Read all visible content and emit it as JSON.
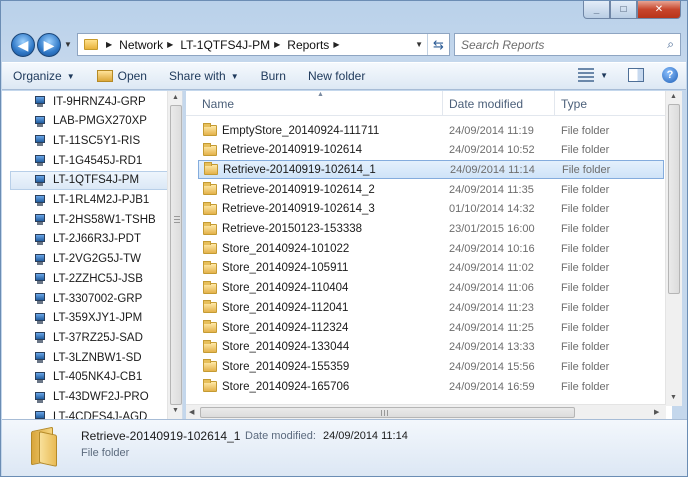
{
  "window": {
    "caption_buttons": [
      "minimize",
      "maximize",
      "close"
    ]
  },
  "address": {
    "crumbs": [
      "Network",
      "LT-1QTFS4J-PM",
      "Reports"
    ]
  },
  "search": {
    "placeholder": "Search Reports"
  },
  "toolbar": {
    "organize": "Organize",
    "open": "Open",
    "share_with": "Share with",
    "burn": "Burn",
    "new_folder": "New folder"
  },
  "nav_pane": {
    "items": [
      {
        "label": "IT-9HRNZ4J-GRP"
      },
      {
        "label": "LAB-PMGX270XP"
      },
      {
        "label": "LT-11SC5Y1-RIS"
      },
      {
        "label": "LT-1G4545J-RD1"
      },
      {
        "label": "LT-1QTFS4J-PM",
        "selected": true
      },
      {
        "label": "LT-1RL4M2J-PJB1"
      },
      {
        "label": "LT-2HS58W1-TSHB"
      },
      {
        "label": "LT-2J66R3J-PDT"
      },
      {
        "label": "LT-2VG2G5J-TW"
      },
      {
        "label": "LT-2ZZHC5J-JSB"
      },
      {
        "label": "LT-3307002-GRP"
      },
      {
        "label": "LT-359XJY1-JPM"
      },
      {
        "label": "LT-37RZ25J-SAD"
      },
      {
        "label": "LT-3LZNBW1-SD"
      },
      {
        "label": "LT-405NK4J-CB1"
      },
      {
        "label": "LT-43DWF2J-PRO"
      },
      {
        "label": "LT-4CDFS4J-AGD"
      }
    ]
  },
  "columns": {
    "name": "Name",
    "date_modified": "Date modified",
    "type": "Type"
  },
  "files": [
    {
      "name": "EmptyStore_20140924-111711",
      "date": "24/09/2014 11:19",
      "type": "File folder"
    },
    {
      "name": "Retrieve-20140919-102614",
      "date": "24/09/2014 10:52",
      "type": "File folder"
    },
    {
      "name": "Retrieve-20140919-102614_1",
      "date": "24/09/2014 11:14",
      "type": "File folder",
      "selected": true
    },
    {
      "name": "Retrieve-20140919-102614_2",
      "date": "24/09/2014 11:35",
      "type": "File folder"
    },
    {
      "name": "Retrieve-20140919-102614_3",
      "date": "01/10/2014 14:32",
      "type": "File folder"
    },
    {
      "name": "Retrieve-20150123-153338",
      "date": "23/01/2015 16:00",
      "type": "File folder"
    },
    {
      "name": "Store_20140924-101022",
      "date": "24/09/2014 10:16",
      "type": "File folder"
    },
    {
      "name": "Store_20140924-105911",
      "date": "24/09/2014 11:02",
      "type": "File folder"
    },
    {
      "name": "Store_20140924-110404",
      "date": "24/09/2014 11:06",
      "type": "File folder"
    },
    {
      "name": "Store_20140924-112041",
      "date": "24/09/2014 11:23",
      "type": "File folder"
    },
    {
      "name": "Store_20140924-112324",
      "date": "24/09/2014 11:25",
      "type": "File folder"
    },
    {
      "name": "Store_20140924-133044",
      "date": "24/09/2014 13:33",
      "type": "File folder"
    },
    {
      "name": "Store_20140924-155359",
      "date": "24/09/2014 15:56",
      "type": "File folder"
    },
    {
      "name": "Store_20140924-165706",
      "date": "24/09/2014 16:59",
      "type": "File folder"
    }
  ],
  "details": {
    "name": "Retrieve-20140919-102614_1",
    "date_label": "Date modified:",
    "date_value": "24/09/2014 11:14",
    "type": "File folder"
  }
}
